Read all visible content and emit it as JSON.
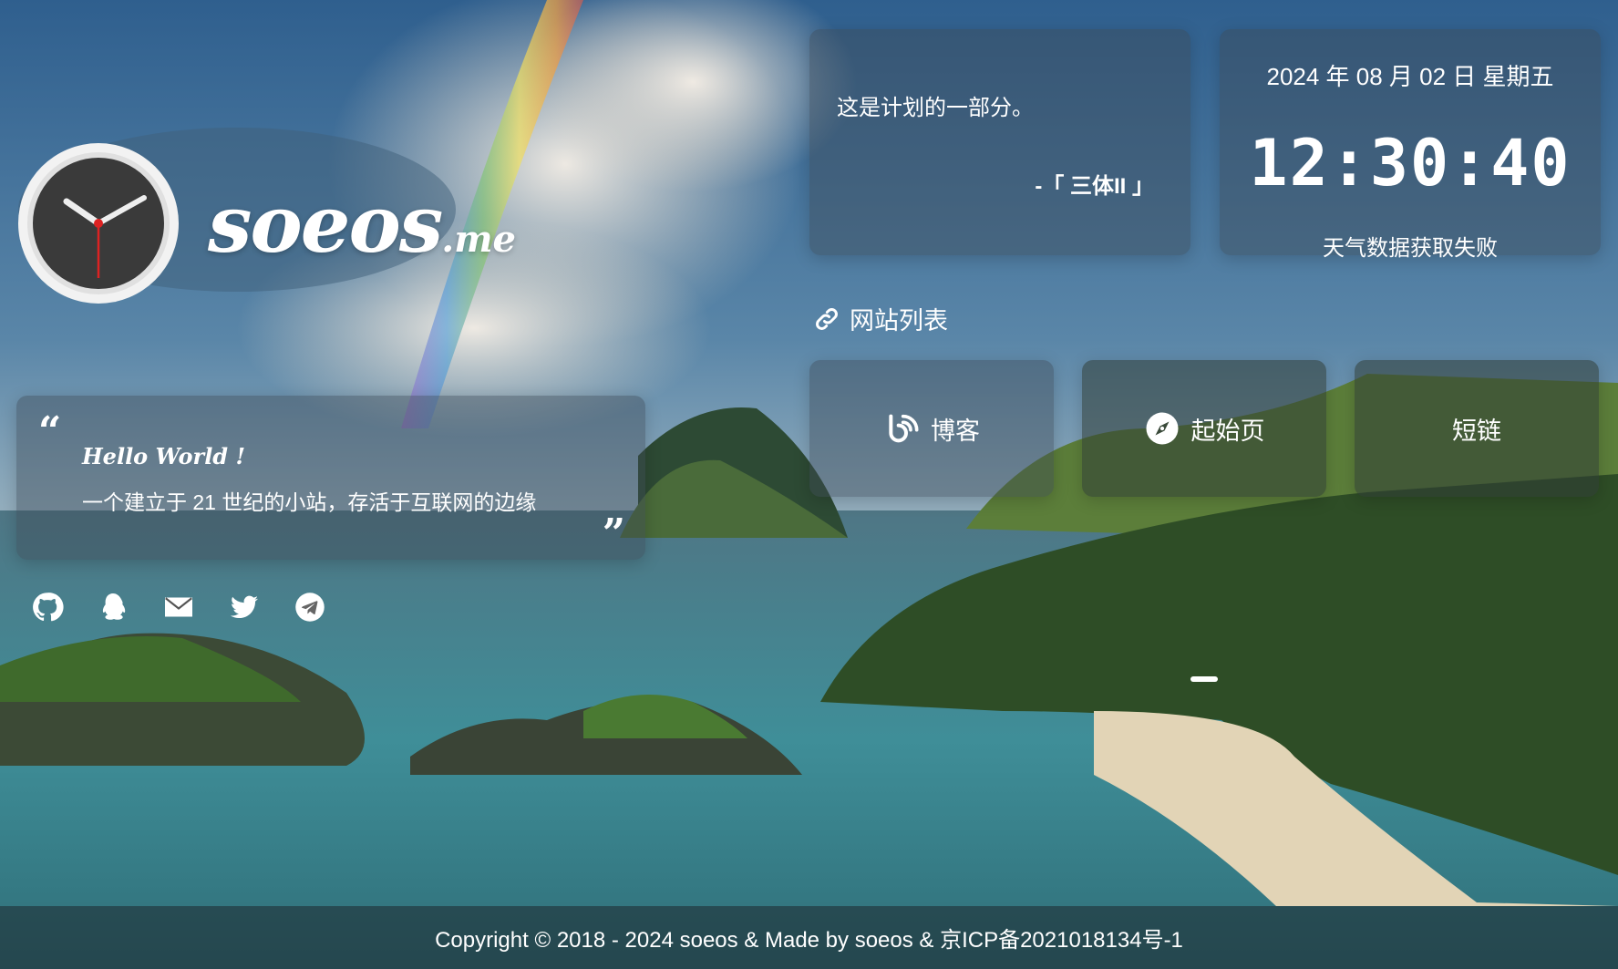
{
  "logo": {
    "name": "soeos",
    "suffix": ".me"
  },
  "hello": {
    "title": "Hello World !",
    "desc": "一个建立于 21 世纪的小站，存活于互联网的边缘",
    "quote_open": "“",
    "quote_close": "”"
  },
  "socials": [
    {
      "icon": "github-icon"
    },
    {
      "icon": "qq-icon"
    },
    {
      "icon": "mail-icon"
    },
    {
      "icon": "twitter-icon"
    },
    {
      "icon": "telegram-icon"
    }
  ],
  "quote": {
    "text": "这是计划的一部分。",
    "source": "-「 三体II 」"
  },
  "time": {
    "date": "2024 年 08 月 02 日 星期五",
    "clock": "12:30:40",
    "weather": "天气数据获取失败"
  },
  "sites": {
    "heading": "网站列表",
    "items": [
      {
        "label": "博客",
        "icon": "blog-feed-icon"
      },
      {
        "label": "起始页",
        "icon": "compass-icon"
      },
      {
        "label": "短链",
        "icon": ""
      }
    ]
  },
  "footer": {
    "text": "Copyright  © 2018 - 2024 soeos & Made by soeos & 京ICP备2021018134号-1"
  }
}
